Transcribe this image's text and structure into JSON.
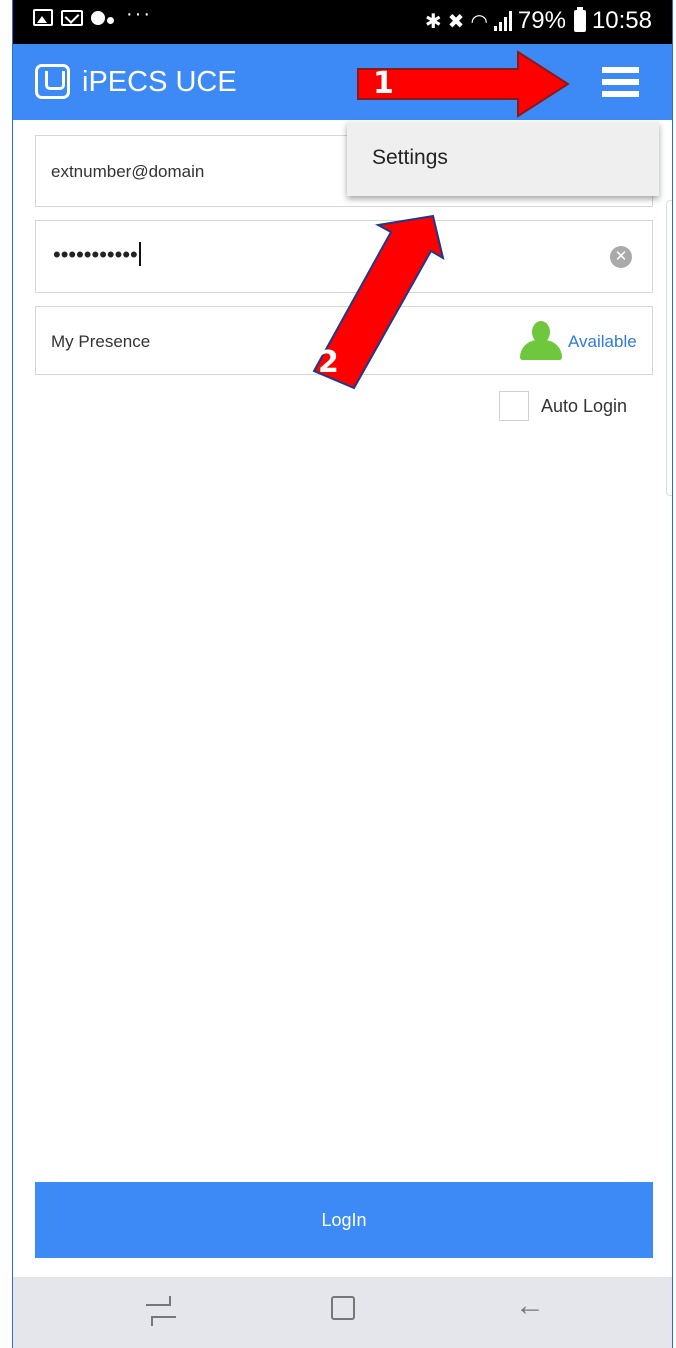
{
  "status_bar": {
    "battery": "79%",
    "time": "10:58",
    "more": "···"
  },
  "app_bar": {
    "title": "iPECS UCE"
  },
  "menu": {
    "items": [
      {
        "label": "Settings"
      }
    ]
  },
  "form": {
    "user_id_value": "extnumber@domain",
    "password_value": "•••••••••••",
    "presence_label": "My Presence",
    "presence_value": "Available",
    "auto_login_label": "Auto Login",
    "auto_login_checked": false
  },
  "login": {
    "label": "LogIn"
  },
  "annotations": {
    "arrow1_number": "1",
    "arrow2_number": "2",
    "arrow_color": "#ff0000"
  },
  "colors": {
    "accent": "#3d8af7",
    "presence_green": "#6ec73c",
    "presence_text": "#2f7bd6"
  },
  "icons": {
    "menu": "hamburger-menu-icon",
    "clear": "clear-circle-x-icon",
    "presence": "person-icon"
  }
}
